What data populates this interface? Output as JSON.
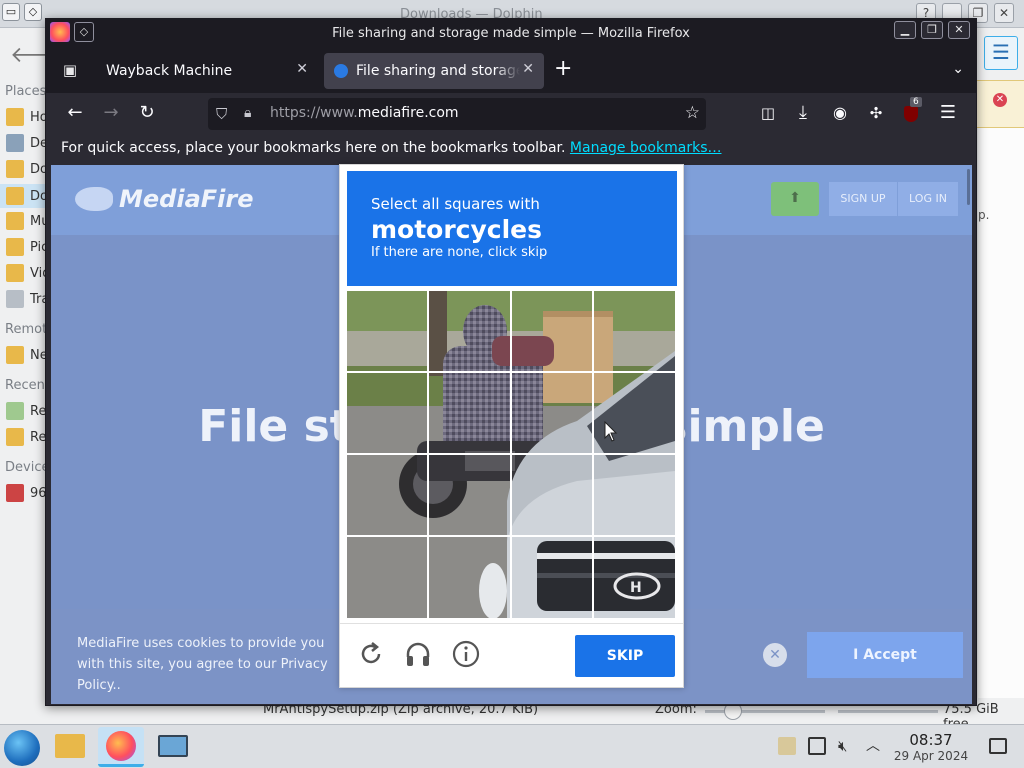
{
  "dolphin": {
    "title": "Downloads — Dolphin",
    "sidebar_sections": [
      "Places",
      "Remote",
      "Recent",
      "Devices"
    ],
    "sidebar_items": [
      "Ho",
      "De",
      "Do",
      "Do",
      "Mu",
      "Pic",
      "Vid",
      "Tra",
      "Ne",
      "Re",
      "Re",
      "96."
    ],
    "right_fragment": "p.",
    "status_file": "MrAntispySetup.zip (Zip archive, 20.7 KiB)",
    "zoom_label": "Zoom:",
    "free_space": "75.5 GiB free"
  },
  "firefox": {
    "window_title": "File sharing and storage made simple — Mozilla Firefox",
    "tabs": [
      {
        "label": "Wayback Machine",
        "active": false
      },
      {
        "label": "File sharing and storage made simple",
        "active": true
      }
    ],
    "url_prefix": "https://www.",
    "url_domain": "mediafire.com",
    "extension_badge": "6",
    "bookmarks_message": "For quick access, place your bookmarks here on the bookmarks toolbar.",
    "bookmarks_link": "Manage bookmarks…"
  },
  "page": {
    "logo_text": "MediaFire",
    "signup": "SIGN UP",
    "login": "LOG IN",
    "hero": "File storage made simple",
    "cookie_text": "MediaFire uses cookies to provide you with this site, you agree to our Privacy Policy..",
    "accept": "I Accept"
  },
  "captcha": {
    "instruction": "Select all squares with",
    "target": "motorcycles",
    "hint": "If there are none, click skip",
    "skip_label": "SKIP",
    "grid_size": 4,
    "footer_icons": [
      "refresh-icon",
      "audio-icon",
      "info-icon"
    ]
  },
  "taskbar": {
    "time": "08:37",
    "date": "29 Apr 2024"
  }
}
